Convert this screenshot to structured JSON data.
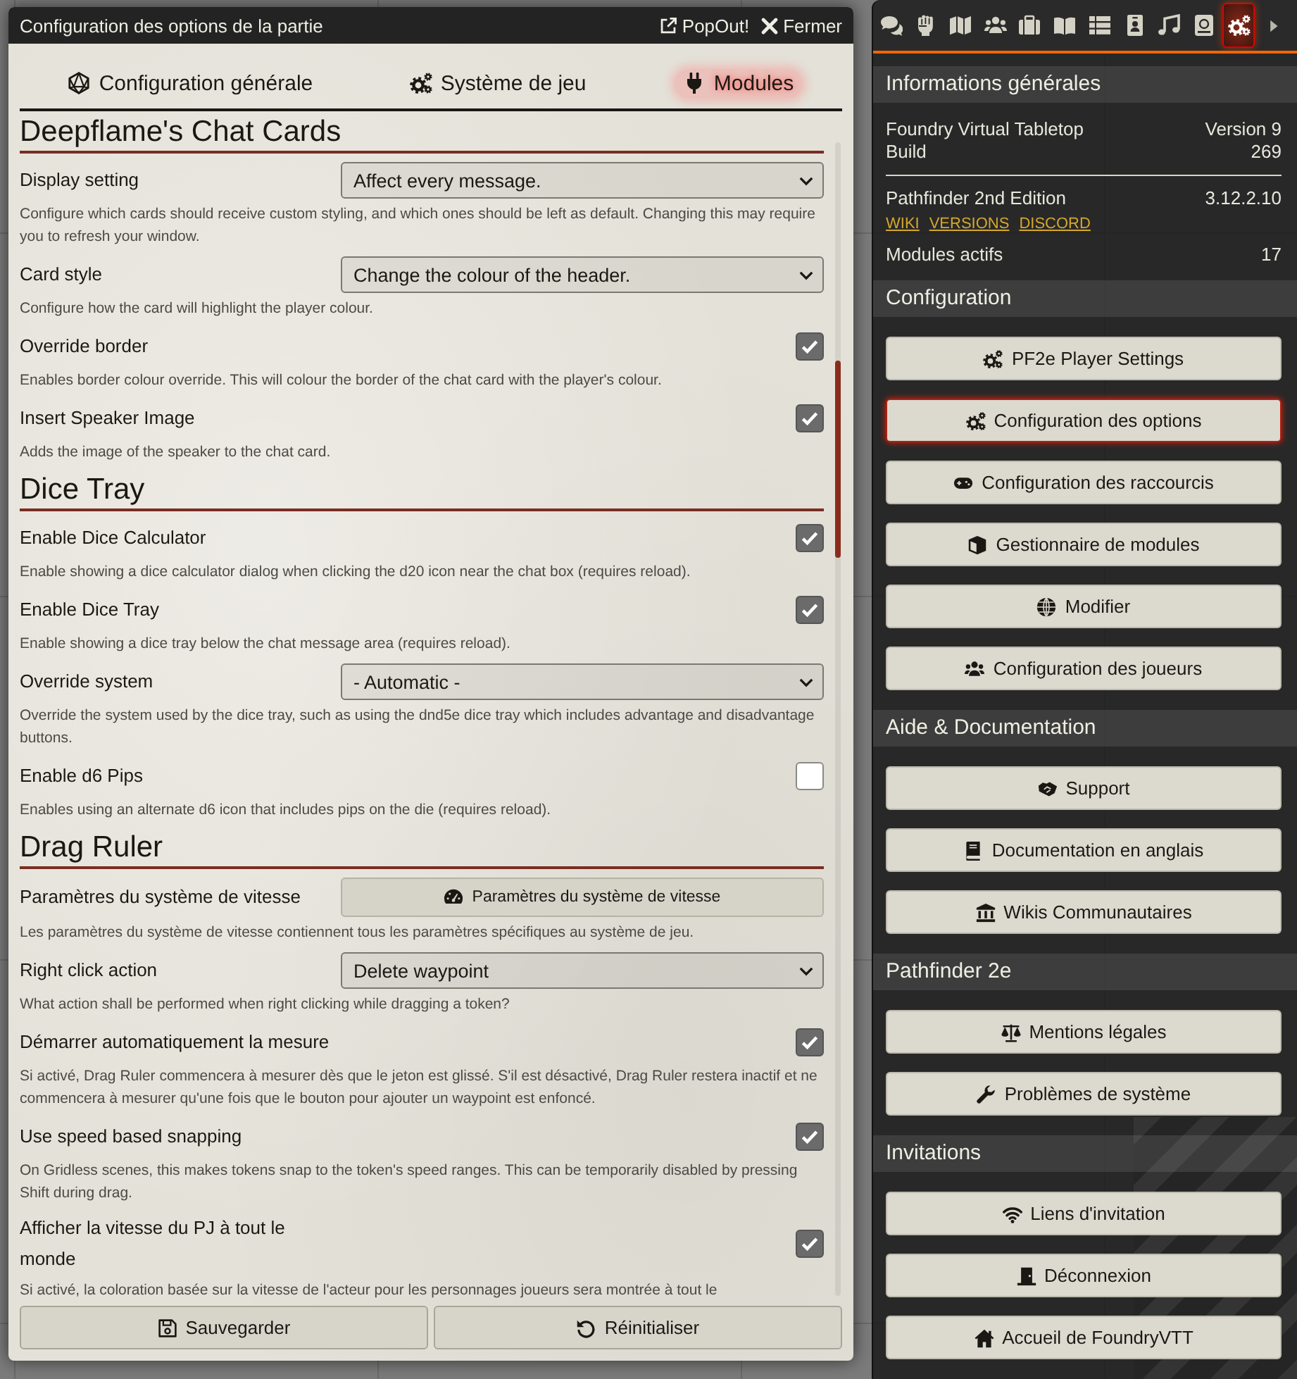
{
  "window": {
    "title": "Configuration des options de la partie",
    "header_buttons": [
      {
        "label": "PopOut!"
      },
      {
        "label": "Fermer"
      }
    ]
  },
  "tabs": [
    {
      "label": "Configuration générale",
      "selected": false
    },
    {
      "label": "Système de jeu",
      "selected": false
    },
    {
      "label": "Modules",
      "selected": true
    }
  ],
  "modules": [
    {
      "title": "Deepflame's Chat Cards",
      "settings": [
        {
          "kind": "select",
          "label": "Display setting",
          "value": "Affect every message.",
          "description": "Configure which cards should receive custom styling, and which ones should be left as default. Changing this may require you to refresh your window."
        },
        {
          "kind": "select",
          "label": "Card style",
          "value": "Change the colour of the header.",
          "description": "Configure how the card will highlight the player colour."
        },
        {
          "kind": "checkbox",
          "label": "Override border",
          "checked": true,
          "description": "Enables border colour override. This will colour the border of the chat card with the player's colour."
        },
        {
          "kind": "checkbox",
          "label": "Insert Speaker Image",
          "checked": true,
          "description": "Adds the image of the speaker to the chat card."
        }
      ]
    },
    {
      "title": "Dice Tray",
      "settings": [
        {
          "kind": "checkbox",
          "label": "Enable Dice Calculator",
          "checked": true,
          "description": "Enable showing a dice calculator dialog when clicking the d20 icon near the chat box (requires reload)."
        },
        {
          "kind": "checkbox",
          "label": "Enable Dice Tray",
          "checked": true,
          "description": "Enable showing a dice tray below the chat message area (requires reload)."
        },
        {
          "kind": "select",
          "label": "Override system",
          "value": "- Automatic -",
          "description": "Override the system used by the dice tray, such as using the dnd5e dice tray which includes advantage and disadvantage buttons."
        },
        {
          "kind": "checkbox",
          "label": "Enable d6 Pips",
          "checked": false,
          "description": "Enables using an alternate d6 icon that includes pips on the die (requires reload)."
        }
      ]
    },
    {
      "title": "Drag Ruler",
      "settings": [
        {
          "kind": "button",
          "label": "Paramètres du système de vitesse",
          "button_label": "Paramètres du système de vitesse",
          "description": "Les paramètres du système de vitesse contiennent tous les paramètres spécifiques au système de jeu."
        },
        {
          "kind": "select",
          "label": "Right click action",
          "value": "Delete waypoint",
          "description": "What action shall be performed when right clicking while dragging a token?"
        },
        {
          "kind": "checkbox",
          "label": "Démarrer automatiquement la mesure",
          "checked": true,
          "description": "Si activé, Drag Ruler commencera à mesurer dès que le jeton est glissé. S'il est désactivé, Drag Ruler restera inactif et ne commencera à mesurer qu'une fois que le bouton pour ajouter un waypoint est enfoncé."
        },
        {
          "kind": "checkbox",
          "label": "Use speed based snapping",
          "checked": true,
          "description": "On Gridless scenes, this makes tokens snap to the token's speed ranges. This can be temporarily disabled by pressing Shift during drag."
        },
        {
          "kind": "checkbox",
          "label": "Afficher la vitesse du PJ à tout le monde",
          "checked": true,
          "description": "Si activé, la coloration basée sur la vitesse de l'acteur pour les personnages joueurs sera montrée à tout le"
        }
      ]
    }
  ],
  "footer": {
    "buttons": [
      {
        "label": "Sauvegarder"
      },
      {
        "label": "Réinitialiser"
      }
    ]
  },
  "sidebar": {
    "tabs": [
      {
        "selected": false
      },
      {
        "selected": false
      },
      {
        "selected": false
      },
      {
        "selected": false
      },
      {
        "selected": false
      },
      {
        "selected": false
      },
      {
        "selected": false
      },
      {
        "selected": false
      },
      {
        "selected": false
      },
      {
        "selected": false
      },
      {
        "selected": true
      }
    ],
    "info": {
      "title": "Informations générales",
      "rows": [
        {
          "label": "Foundry Virtual Tabletop",
          "value": "Version 9"
        },
        {
          "label": "Build",
          "value": "269"
        }
      ],
      "system": {
        "label": "Pathfinder 2nd Edition",
        "value": "3.12.2.10",
        "links": [
          "WIKI",
          "VERSIONS",
          "DISCORD"
        ]
      },
      "modules": {
        "label": "Modules actifs",
        "value": "17"
      }
    },
    "sections": [
      {
        "title": "Configuration",
        "buttons": [
          {
            "label": "PF2e Player Settings",
            "active": false
          },
          {
            "label": "Configuration des options",
            "active": true
          },
          {
            "label": "Configuration des raccourcis",
            "active": false
          },
          {
            "label": "Gestionnaire de modules",
            "active": false
          },
          {
            "label": "Modifier",
            "active": false
          },
          {
            "label": "Configuration des joueurs",
            "active": false
          }
        ]
      },
      {
        "title": "Aide & Documentation",
        "buttons": [
          {
            "label": "Support",
            "active": false
          },
          {
            "label": "Documentation en anglais",
            "active": false
          },
          {
            "label": "Wikis Communautaires",
            "active": false
          }
        ]
      },
      {
        "title": "Pathfinder 2e",
        "buttons": [
          {
            "label": "Mentions légales",
            "active": false
          },
          {
            "label": "Problèmes de système",
            "active": false
          }
        ]
      },
      {
        "title": "Invitations",
        "buttons": [
          {
            "label": "Liens d'invitation",
            "active": false
          },
          {
            "label": "Déconnexion",
            "active": false
          },
          {
            "label": "Accueil de FoundryVTT",
            "active": false
          }
        ]
      }
    ]
  }
}
